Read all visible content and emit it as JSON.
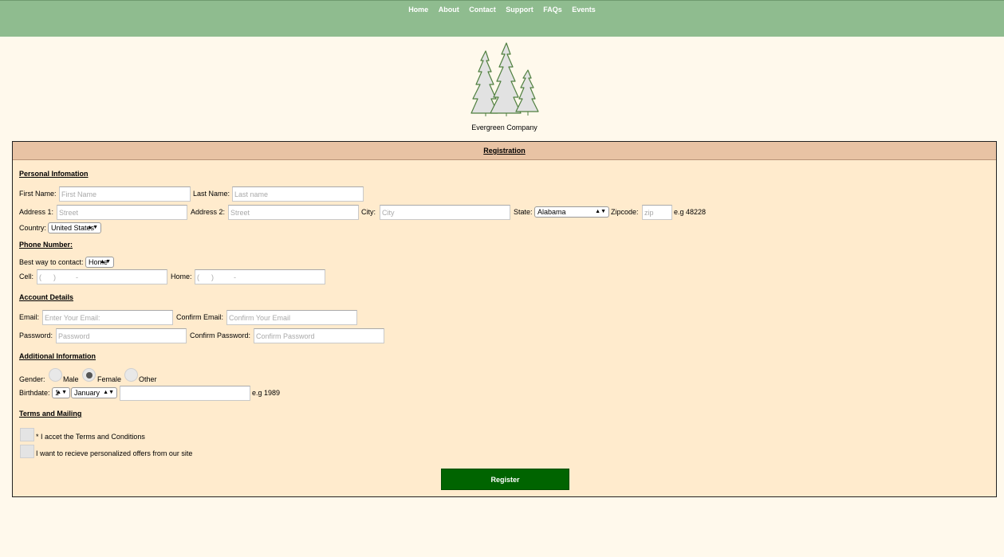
{
  "nav": [
    "Home",
    "About",
    "Contact",
    "Support",
    "FAQs",
    "Events"
  ],
  "company": "Evergreen Company",
  "panel_title": "Registration",
  "personal": {
    "heading": "Personal Infomation",
    "first_label": "First Name:",
    "first_ph": "First Name",
    "last_label": "Last Name:",
    "last_ph": "Last name",
    "addr1_label": "Address 1:",
    "addr1_ph": "Street",
    "addr2_label": "Address 2:",
    "addr2_ph": "Street",
    "city_label": "City:",
    "city_ph": "City",
    "state_label": "State:",
    "state_value": "Alabama",
    "zip_label": "Zipcode:",
    "zip_ph": "zip",
    "zip_hint": "e.g 48228",
    "country_label": "Country:",
    "country_value": "United States"
  },
  "phone": {
    "heading": "Phone Number:",
    "contact_label": "Best way to contact:",
    "contact_value": "Home",
    "cell_label": "Cell:",
    "cell_ph": "(      )          -",
    "home_label": "Home:",
    "home_ph": "(      )          -"
  },
  "account": {
    "heading": "Account Details",
    "email_label": "Email:",
    "email_ph": "Enter Your Email:",
    "cemail_label": "Confirm Email:",
    "cemail_ph": "Confirm Your Email",
    "pass_label": "Password:",
    "pass_ph": "Password",
    "cpass_label": "Confirm Password:",
    "cpass_ph": "Confirm Password"
  },
  "additional": {
    "heading": "Additional Information",
    "gender_label": "Gender:",
    "gender_options": [
      "Male",
      "Female",
      "Other"
    ],
    "gender_selected": "Female",
    "birth_label": "Birthdate:",
    "day_value": "1",
    "month_value": "January",
    "year_hint": "e.g 1989"
  },
  "terms": {
    "heading": "Terms and Mailing",
    "accept": "* I accet the Terms and Conditions",
    "offers": "I want to recieve personalized offers from our site"
  },
  "register_label": "Register"
}
